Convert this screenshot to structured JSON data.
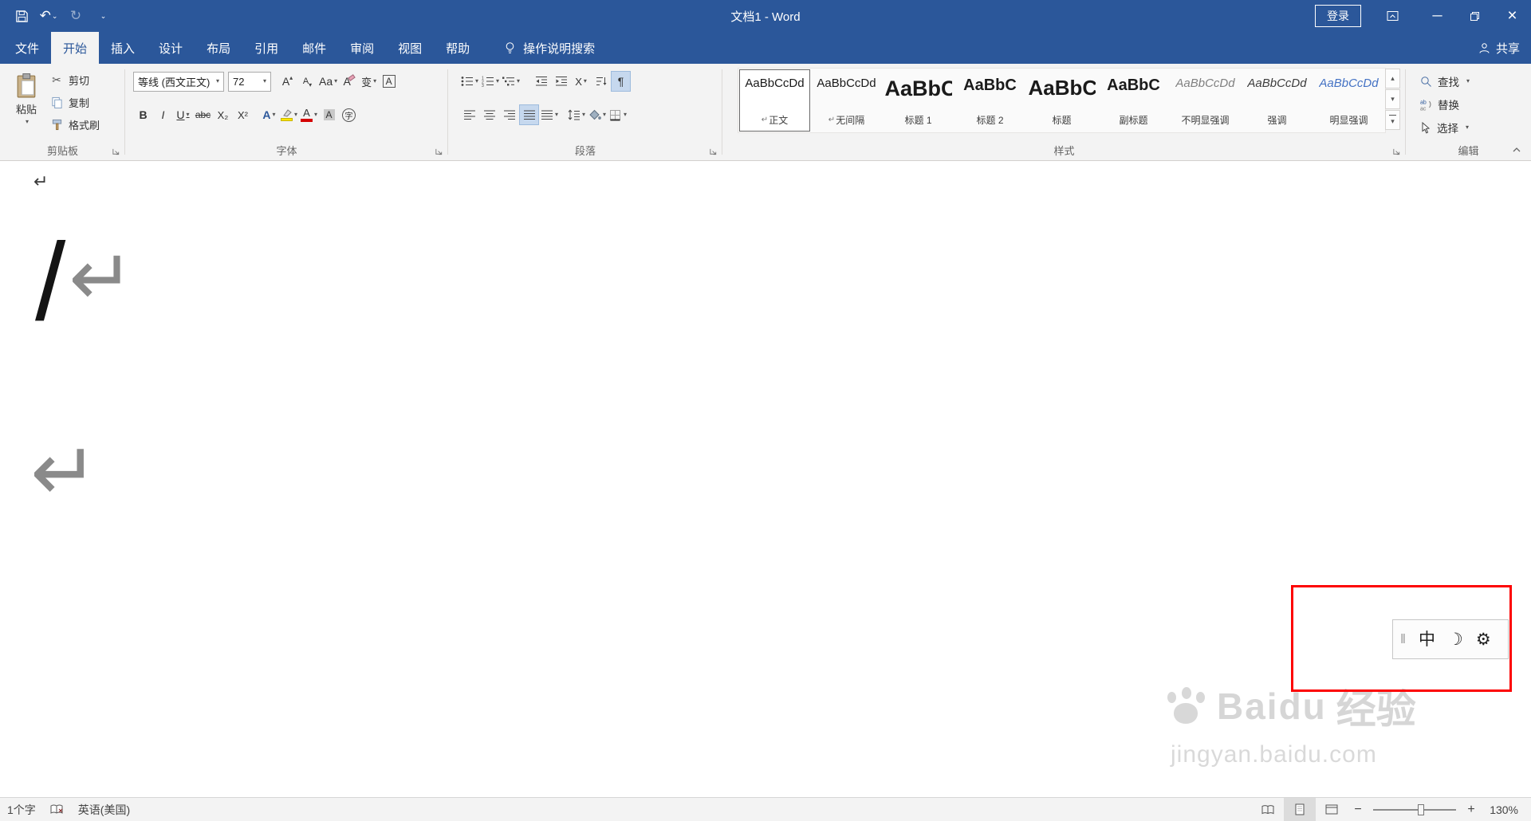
{
  "colors": {
    "titlebar_blue": "#2b579a",
    "ribbon_gray": "#f3f3f3",
    "annotation_red": "#fd0303",
    "highlight_yellow": "#ffe800",
    "font_color_red": "#d40000",
    "intense_emphasis_blue": "#4472c4"
  },
  "titlebar": {
    "title": "文档1 - Word",
    "signin": "登录"
  },
  "ribbon_tabs": [
    "文件",
    "开始",
    "插入",
    "设计",
    "布局",
    "引用",
    "邮件",
    "审阅",
    "视图",
    "帮助"
  ],
  "labels": {
    "tell_me": "操作说明搜索",
    "share": "共享"
  },
  "clipboard": {
    "label": "剪贴板",
    "paste": "粘贴",
    "cut": "剪切",
    "copy": "复制",
    "format_painter": "格式刷"
  },
  "font": {
    "label": "字体",
    "font_name": "等线 (西文正文)",
    "font_size": "72",
    "bold": "B",
    "italic": "I",
    "underline": "U",
    "strikethrough": "abc",
    "subscript": "X₂",
    "superscript": "X²",
    "text_effects": "A",
    "change_case": "Aa",
    "grow_font": "A",
    "shrink_font": "A",
    "clear_formatting": "A",
    "phonetic_guide": "变",
    "character_border": "A",
    "highlight": "ab",
    "font_color": "A",
    "character_shading": "A",
    "enclose_character": "字"
  },
  "paragraph": {
    "label": "段落",
    "asian_layout": "X"
  },
  "styles": {
    "label": "样式",
    "items": [
      {
        "preview": "AaBbCcDd",
        "name": "正文"
      },
      {
        "preview": "AaBbCcDd",
        "name": "无间隔"
      },
      {
        "preview": "AaBbC",
        "name": "标题 1"
      },
      {
        "preview": "AaBbC",
        "name": "标题 2"
      },
      {
        "preview": "AaBbC",
        "name": "标题"
      },
      {
        "preview": "AaBbC",
        "name": "副标题"
      },
      {
        "preview": "AaBbCcDd",
        "name": "不明显强调"
      },
      {
        "preview": "AaBbCcDd",
        "name": "强调"
      },
      {
        "preview": "AaBbCcDd",
        "name": "明显强调"
      }
    ]
  },
  "editing": {
    "label": "编辑",
    "find": "查找",
    "replace": "替换",
    "select": "选择"
  },
  "document": {
    "text": "/"
  },
  "ime": {
    "mode": "中"
  },
  "watermark": {
    "brand": "Baidu",
    "brand_cn": "经验",
    "url": "jingyan.baidu.com"
  },
  "statusbar": {
    "word_count": "1个字",
    "language": "英语(美国)",
    "zoom": "130%",
    "zoom_out": "−",
    "zoom_in": "+"
  },
  "icons": {
    "undo": "↶",
    "redo": "↻",
    "caret_down": "▾",
    "caret_up": "▴",
    "chevron_small": "⌄",
    "minimize": "─",
    "close": "×",
    "scissors": "✂",
    "pilcrow": "¶",
    "return_mark": "↵",
    "moon": "☽",
    "gear": "⚙",
    "handle": "‖"
  }
}
